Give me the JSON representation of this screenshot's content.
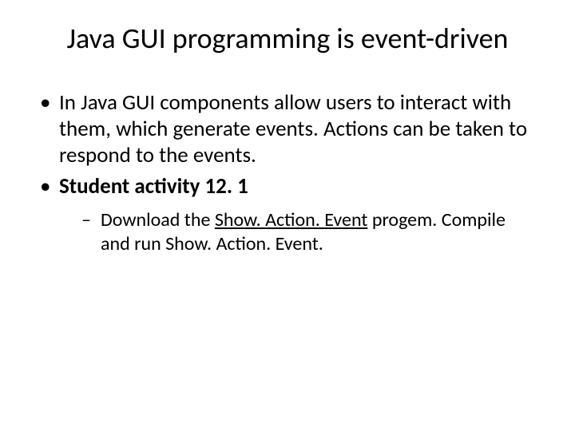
{
  "title": "Java GUI programming is event-driven",
  "bullets": {
    "b1": "In Java GUI components allow users to interact with them, which generate events. Actions can be taken to respond to the events.",
    "b2": "Student activity 12. 1",
    "sub1_pre": "Download the ",
    "sub1_link": "Show. Action. Event",
    "sub1_post": "  progem. Compile and run Show. Action. Event."
  }
}
